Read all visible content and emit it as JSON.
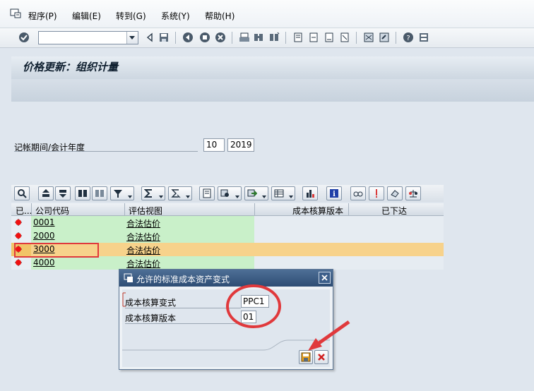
{
  "menu": {
    "items": [
      "程序(P)",
      "编辑(E)",
      "转到(G)",
      "系统(Y)",
      "帮助(H)"
    ]
  },
  "toolbar": {
    "command_value": ""
  },
  "page": {
    "title": "价格更新：组织计量"
  },
  "selection": {
    "period_label": "记帐期间/会计年度",
    "period": "10",
    "year": "2019"
  },
  "grid": {
    "columns": [
      "已...",
      "公司代码",
      "评估视图",
      "成本核算版本",
      "已下达"
    ],
    "rows": [
      {
        "company_code": "0001",
        "valuation_view": "合法估价",
        "costing_version": "",
        "released": "",
        "highlighted": false
      },
      {
        "company_code": "2000",
        "valuation_view": "合法估价",
        "costing_version": "",
        "released": "",
        "highlighted": false
      },
      {
        "company_code": "3000",
        "valuation_view": "合法估价",
        "costing_version": "",
        "released": "",
        "highlighted": true
      },
      {
        "company_code": "4000",
        "valuation_view": "合法估价",
        "costing_version": "",
        "released": "",
        "highlighted": false
      }
    ]
  },
  "dialog": {
    "title": "允许的标准成本资产变式",
    "fields": [
      {
        "label": "成本核算变式",
        "value": "PPC1"
      },
      {
        "label": "成本核算版本",
        "value": "01"
      }
    ]
  },
  "colors": {
    "title_bar": "#2e4d74",
    "green_cell": "#c9f0c9",
    "highlight_row": "#f7d28b",
    "annotation_red": "#e0393c"
  }
}
